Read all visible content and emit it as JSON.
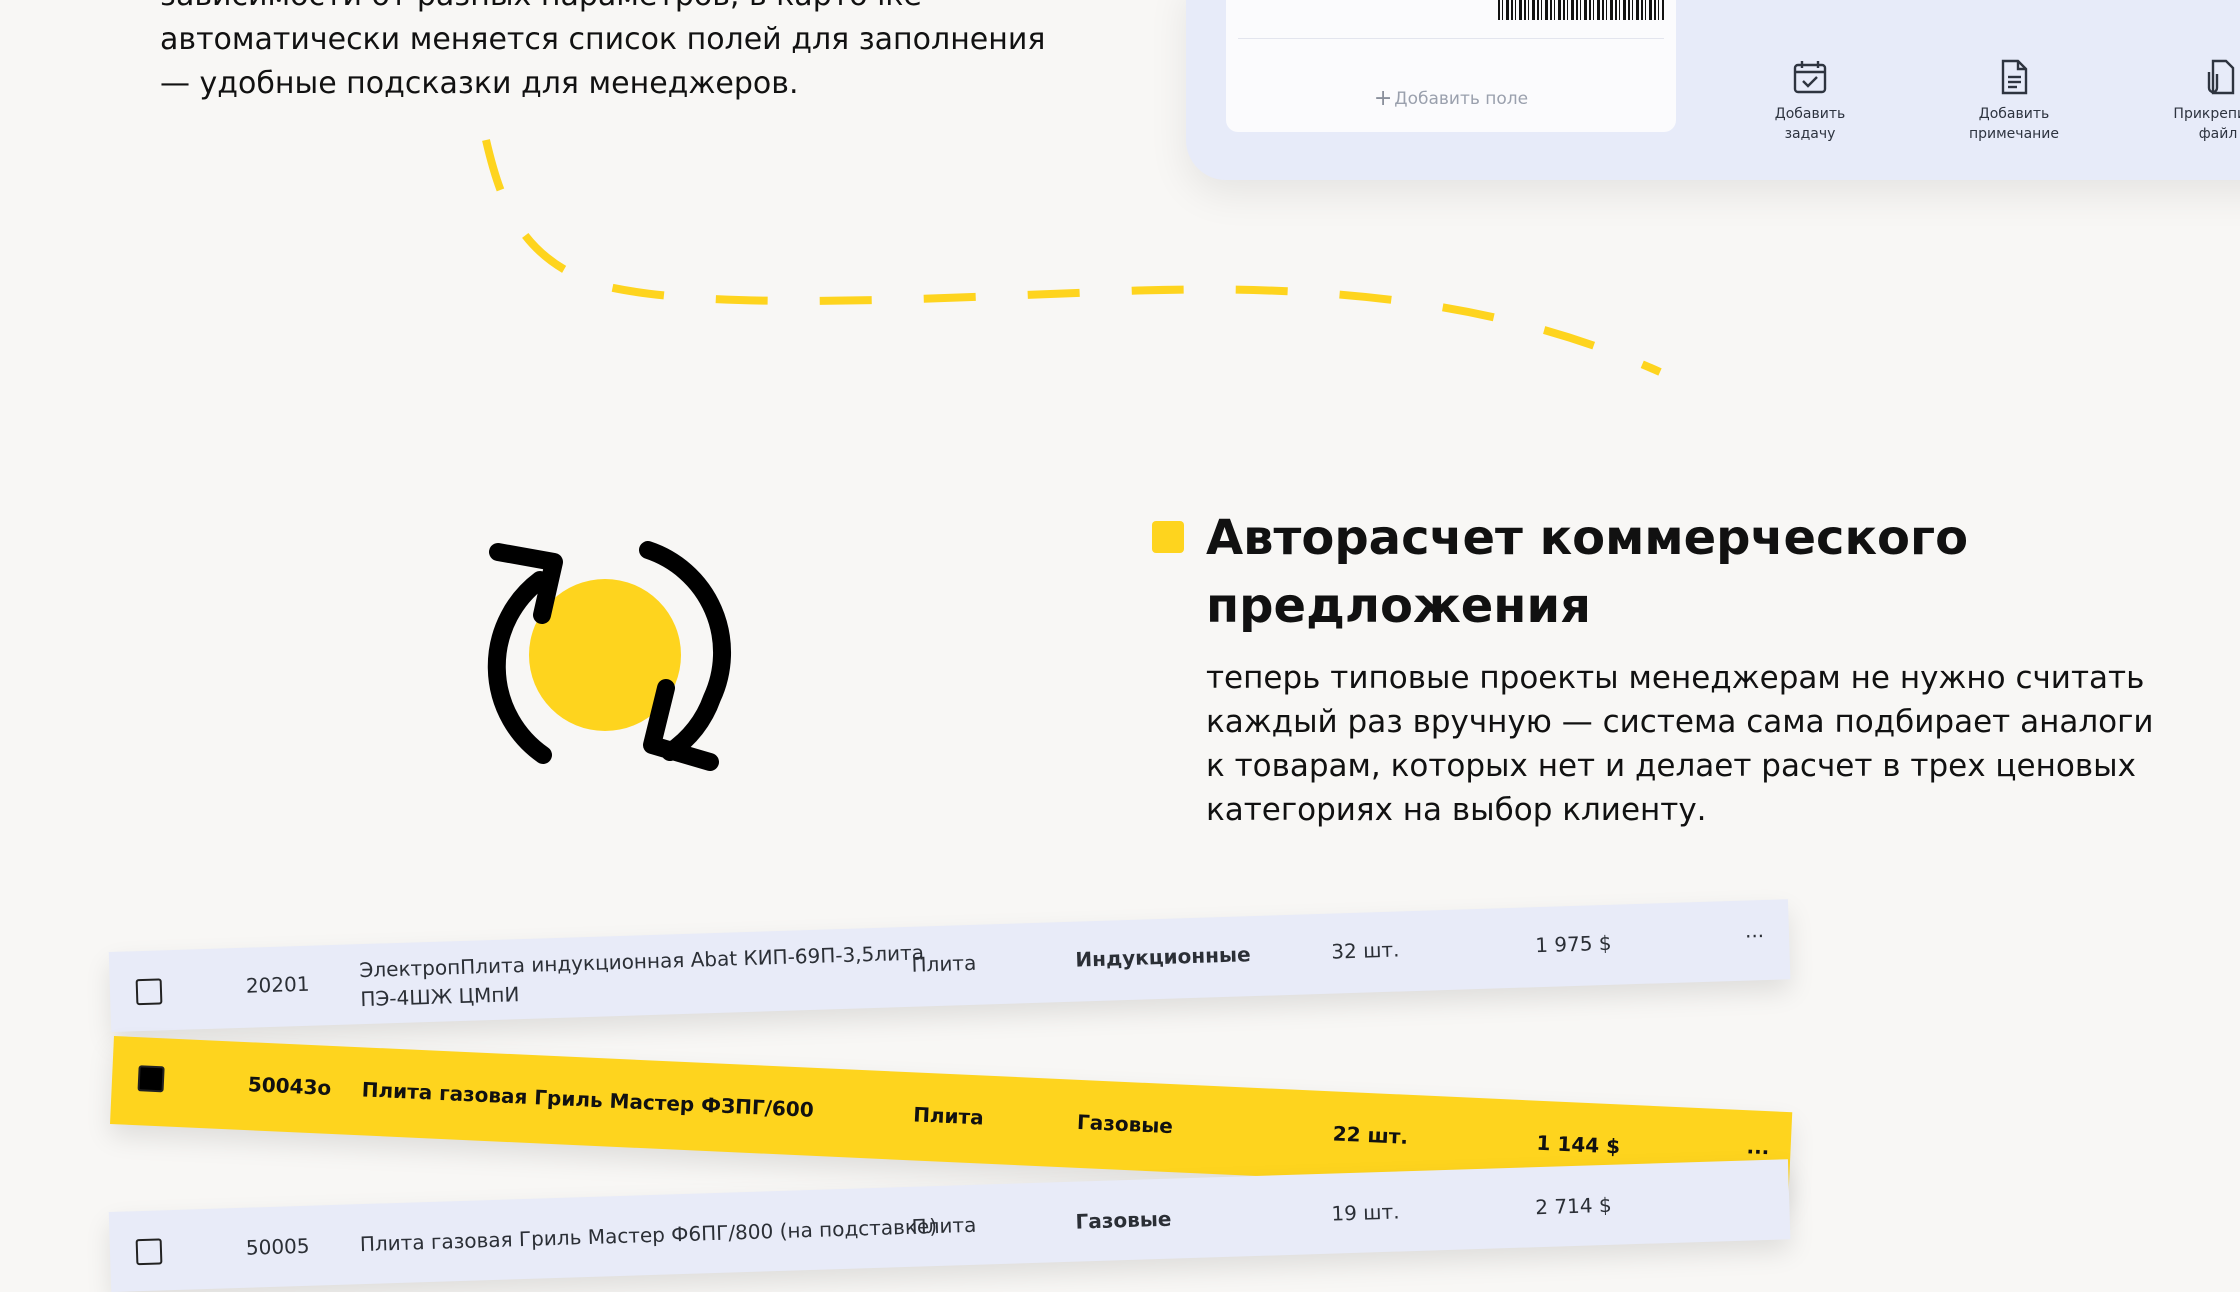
{
  "intro": {
    "line1": "зависимости от разных параметров, в карточке",
    "line2": "автоматически меняется список полей для заполнения",
    "line3": "— удобные подсказки для менеджеров."
  },
  "card": {
    "add_field_label": "Добавить поле",
    "actions": [
      {
        "icon": "calendar-check-icon",
        "line1": "Добавить",
        "line2": "задачу"
      },
      {
        "icon": "document-icon",
        "line1": "Добавить",
        "line2": "примечание"
      },
      {
        "icon": "paperclip-file-icon",
        "line1": "Прикрепить",
        "line2": "файл"
      }
    ]
  },
  "feature": {
    "title_line1": "Авторасчет коммерческого",
    "title_line2": "предложения",
    "body": "теперь типовые проекты менеджерам не нужно считать каждый раз вручную — система сама подбирает аналоги к товарам, которых нет и делает расчет в трех ценовых категориях на выбор клиенту."
  },
  "products": [
    {
      "checked": false,
      "code": "20201",
      "name_line1": "ЭлектропПлита индукционная Abat КИП-69П-3,5лита",
      "name_line2": "ПЭ-4ШЖ ЦМпИ",
      "type": "Плита",
      "category": "Индукционные",
      "qty": "32 шт.",
      "price": "1 975 $",
      "more": "..."
    },
    {
      "checked": true,
      "code": "50043о",
      "name_line1": "Плита газовая Гриль Мастер ФЗПГ/600",
      "name_line2": "",
      "type": "Плита",
      "category": "Газовые",
      "qty": "22 шт.",
      "price": "1 144 $",
      "more": "..."
    },
    {
      "checked": false,
      "code": "50005",
      "name_line1": "Плита газовая Гриль Мастер Ф6ПГ/800 (на подставке)",
      "name_line2": "",
      "type": "Плита",
      "category": "Газовые",
      "qty": "19 шт.",
      "price": "2 714 $",
      "more": ""
    }
  ],
  "colors": {
    "accent": "#fed41e",
    "row_bg": "#e8ebf8",
    "background": "#f8f7f5"
  }
}
